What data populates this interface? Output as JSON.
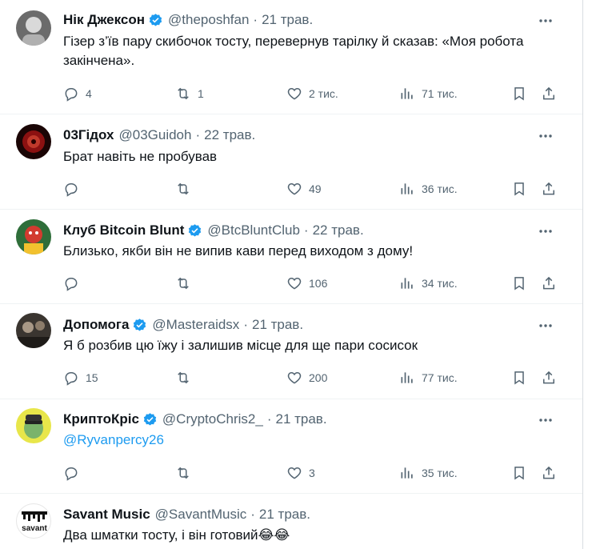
{
  "colors": {
    "verified": "#1d9bf0",
    "mention": "#1d9bf0",
    "secondary_text": "#536471"
  },
  "tweets": [
    {
      "name": "Нік Джексон",
      "verified": true,
      "handle": "@theposhfan",
      "date": "21 трав.",
      "text_line1": "Гізер з’їв пару скибочок тосту, перевернув тарілку й сказав: «Моя робота",
      "text_line2": "закінчена».",
      "replies": "4",
      "retweets": "1",
      "likes": "2 тис.",
      "views": "71 тис."
    },
    {
      "name": "03Гідох",
      "verified": false,
      "handle": "@03Guidoh",
      "date": "22 трав.",
      "text": "Брат навіть не пробував",
      "replies": "",
      "retweets": "",
      "likes": "49",
      "views": "36 тис."
    },
    {
      "name": "Клуб Bitcoin Blunt",
      "verified": true,
      "handle": "@BtcBluntClub",
      "date": "22 трав.",
      "text": "Близько, якби він не випив кави перед виходом з дому!",
      "replies": "",
      "retweets": "",
      "likes": "106",
      "views": "34 тис."
    },
    {
      "name": "Допомога",
      "verified": true,
      "handle": "@Masteraidsx",
      "date": "21 трав.",
      "text": "Я б розбив цю їжу і залишив місце для ще пари сосисок",
      "replies": "15",
      "retweets": "",
      "likes": "200",
      "views": "77 тис."
    },
    {
      "name": "КриптоКріс",
      "verified": true,
      "handle": "@CryptoChris2_",
      "date": "21 трав.",
      "text": "@Ryvanpercy26",
      "replies": "",
      "retweets": "",
      "likes": "3",
      "views": "35 тис."
    },
    {
      "name": "Savant Music",
      "verified": false,
      "handle": "@SavantMusic",
      "date": "21 трав.",
      "text": "Два шматки тосту, і він готовий",
      "emoji": "😂😂",
      "avatar_label": "savant"
    }
  ]
}
